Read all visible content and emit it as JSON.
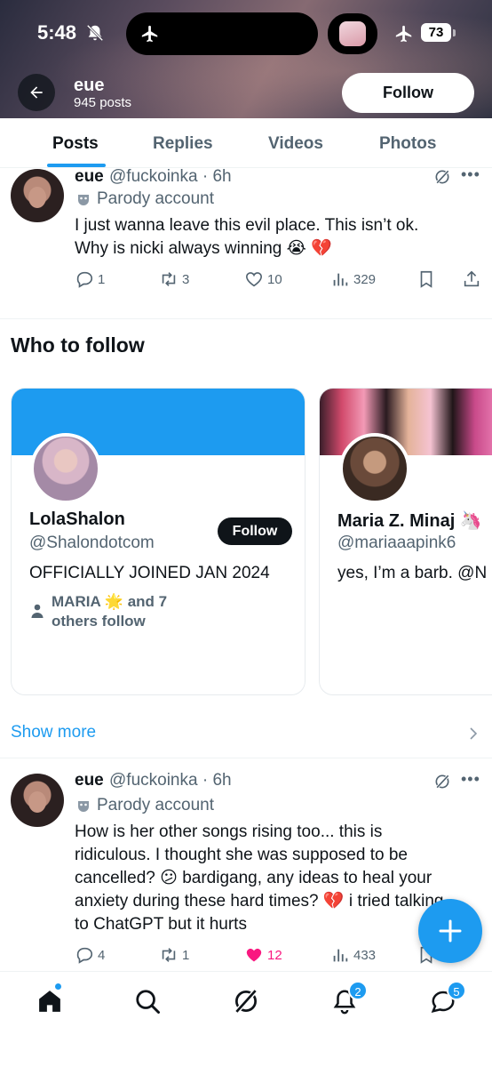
{
  "status_bar": {
    "time": "5:48",
    "battery": "73"
  },
  "header": {
    "name": "eue",
    "post_count": "945 posts",
    "follow_label": "Follow"
  },
  "tabs": [
    {
      "label": "Posts",
      "active": true
    },
    {
      "label": "Replies",
      "active": false
    },
    {
      "label": "Videos",
      "active": false
    },
    {
      "label": "Photos",
      "active": false
    }
  ],
  "tweets": [
    {
      "name": "eue",
      "handle": "@fuckoinka · 6h",
      "label": "Parody account",
      "text_lines": [
        "I just wanna leave this evil place. This isn’t ok.",
        "Why is nicki always winning 😭 💔"
      ],
      "replies": "1",
      "reposts": "3",
      "likes": "10",
      "views": "329",
      "liked": false
    },
    {
      "name": "eue",
      "handle": "@fuckoinka · 6h",
      "label": "Parody account",
      "text_lines": [
        "How is her other songs rising too... this is",
        "ridiculous. I thought she was supposed to be",
        "cancelled? 😕 bardigang, any ideas to heal your",
        "anxiety during these hard times? 💔 i tried talking",
        "to ChatGPT but it hurts"
      ],
      "replies": "4",
      "reposts": "1",
      "likes": "12",
      "views": "433",
      "liked": true
    }
  ],
  "who_to_follow": {
    "title": "Who to follow",
    "cards": [
      {
        "name": "LolaShalon",
        "handle": "@Shalondotcom",
        "bio": "OFFICIALLY JOINED JAN 2024",
        "follow_label": "Follow",
        "social_line1": "MARIA 🌟 and 7",
        "social_line2": "others follow",
        "banner_color": "#1d9bf0"
      },
      {
        "name": "Maria Z. Minaj 🦄",
        "handle": "@mariaaapink6",
        "bio": "yes, I’m a barb. @N"
      }
    ],
    "show_more": "Show more"
  },
  "bottom_nav": {
    "items": [
      "home-icon",
      "search-icon",
      "grok-icon",
      "notifications-icon",
      "messages-icon"
    ],
    "notifications_badge": "2",
    "messages_badge": "5"
  }
}
